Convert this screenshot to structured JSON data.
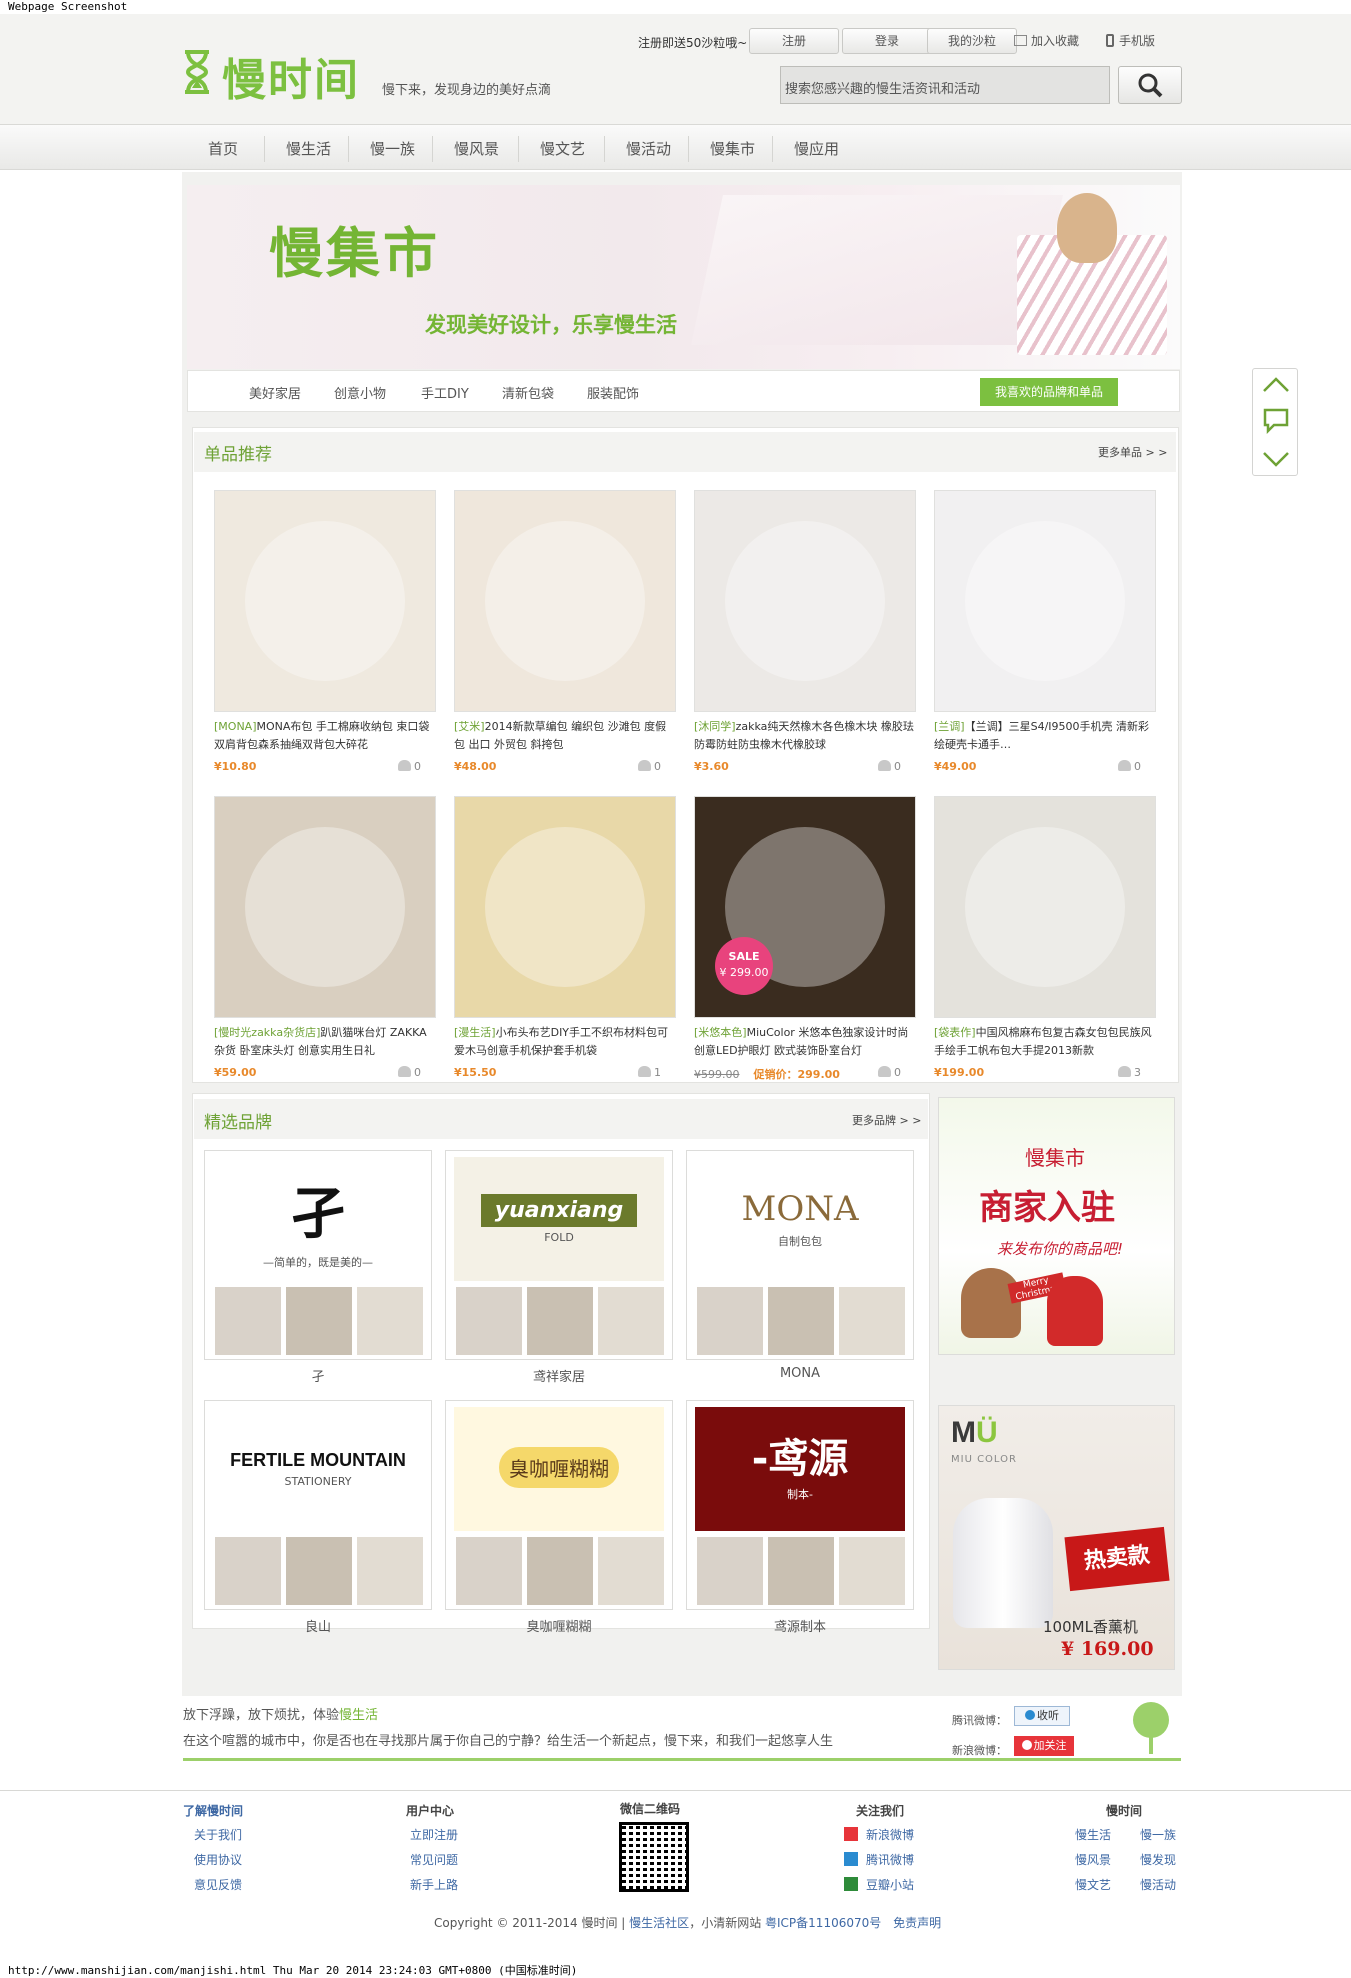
{
  "caption": "Webpage Screenshot",
  "url_footer": "http://www.manshijian.com/manjishi.html Thu Mar 20 2014 23:24:03 GMT+0800 (中国标准时间)",
  "header": {
    "logo_text": "慢时间",
    "slogan": "慢下来，发现身边的美好点滴",
    "promo": "注册即送50沙粒哦~",
    "buttons": {
      "register": "注册",
      "login": "登录",
      "my_sand": "我的沙粒"
    },
    "bookmark": "加入收藏",
    "mobile": "手机版",
    "search_placeholder": "搜索您感兴趣的慢生活资讯和活动"
  },
  "nav": [
    "首页",
    "慢生活",
    "慢一族",
    "慢风景",
    "慢文艺",
    "慢活动",
    "慢集市",
    "慢应用"
  ],
  "banner": {
    "title": "慢集市",
    "subtitle": "发现美好设计，乐享慢生活"
  },
  "subnav": {
    "items": [
      "美好家居",
      "创意小物",
      "手工DIY",
      "清新包袋",
      "服装配饰"
    ],
    "button": "我喜欢的品牌和单品"
  },
  "products": {
    "title": "单品推荐",
    "more": "更多单品 > >",
    "items": [
      {
        "tag": "[MONA]",
        "desc": "MONA布包 手工棉麻收纳包 束口袋双肩背包森系抽绳双背包大碎花",
        "price": "¥10.80",
        "likes": "0"
      },
      {
        "tag": "[艾米]",
        "desc": "2014新款草编包 编织包 沙滩包 度假包 出口 外贸包 斜挎包",
        "price": "¥48.00",
        "likes": "0"
      },
      {
        "tag": "[沐同学]",
        "desc": "zakka纯天然橡木各色橡木块 橡胶珐 防霉防蛀防虫橡木代橡胶球",
        "price": "¥3.60",
        "likes": "0"
      },
      {
        "tag": "[兰调]",
        "desc": "【兰调】三星S4/I9500手机壳 清新彩绘硬壳卡通手…",
        "price": "¥49.00",
        "likes": "0"
      },
      {
        "tag": "[慢时光zakka杂货店]",
        "desc": "趴趴猫咪台灯 ZAKKA杂货 卧室床头灯 创意实用生日礼",
        "price": "¥59.00",
        "likes": "0"
      },
      {
        "tag": "[漫生活]",
        "desc": "小布头布艺DIY手工不织布材料包可爱木马创意手机保护套手机袋",
        "price": "¥15.50",
        "likes": "1"
      },
      {
        "tag": "[米悠本色]",
        "desc": "MiuColor 米悠本色独家设计时尚创意LED护眼灯 欧式装饰卧室台灯",
        "price": "促销价：299.00",
        "old_price": "¥599.00",
        "likes": "0",
        "sale": "SALE",
        "sale_price": "¥ 299.00"
      },
      {
        "tag": "[袋表作]",
        "desc": "中国风棉麻布包复古森女包包民族风手绘手工帆布包大手提2013新款",
        "price": "¥199.00",
        "likes": "3"
      }
    ]
  },
  "brands": {
    "title": "精选品牌",
    "more": "更多品牌 > >",
    "items": [
      {
        "name": "孑",
        "logo": "孑",
        "logo_sub": "—简单的，既是美的—"
      },
      {
        "name": "鸢祥家居",
        "logo": "yuanxiang",
        "logo_sub": "FOLD"
      },
      {
        "name": "MONA",
        "logo": "MONA",
        "logo_sub": "自制包包"
      },
      {
        "name": "良山",
        "logo": "FERTILE MOUNTAIN",
        "logo_sub": "STATIONERY"
      },
      {
        "name": "臭咖喱糊糊",
        "logo": "臭咖喱糊糊",
        "logo_sub": ""
      },
      {
        "name": "鸢源制本",
        "logo": "-鸢源",
        "logo_sub": "制本-"
      }
    ]
  },
  "ads": {
    "merchant": {
      "line1": "慢集市",
      "line2": "商家入驻",
      "line3": "来发布你的商品吧!",
      "merry": "Merry Christmas"
    },
    "miu": {
      "brand": "MIU COLOR",
      "hot": "热卖款",
      "product": "100ML香薰机",
      "price": "¥ 169.00"
    }
  },
  "intro": {
    "line1_pre": "放下浮躁，放下烦扰，体验",
    "line1_link": "慢生活",
    "line2": "在这个喧嚣的城市中，你是否也在寻找那片属于你自己的宁静？给生活一个新起点，慢下来，和我们一起悠享人生",
    "tencent_label": "腾讯微博：",
    "tencent_btn": "收听",
    "sina_label": "新浪微博：",
    "sina_btn": "加关注"
  },
  "footer": {
    "col1": {
      "title": "了解慢时间",
      "links": [
        "关于我们",
        "使用协议",
        "意见反馈"
      ]
    },
    "col2": {
      "title": "用户中心",
      "links": [
        "立即注册",
        "常见问题",
        "新手上路"
      ]
    },
    "col3": {
      "title": "微信二维码"
    },
    "col4": {
      "title": "关注我们",
      "links": [
        "新浪微博",
        "腾讯微博",
        "豆瓣小站"
      ]
    },
    "col5": {
      "title": "慢时间",
      "links": [
        "慢生活",
        "慢一族",
        "慢风景",
        "慢发现",
        "慢文艺",
        "慢活动"
      ]
    },
    "copyright_pre": "Copyright © 2011-2014 慢时间 | ",
    "copyright_link1": "慢生活社区",
    "copyright_mid": "，小清新网站 ",
    "copyright_link2": "粤ICP备11106070号",
    "copyright_link3": "免责声明"
  },
  "colors": {
    "brand_green": "#7cc040",
    "title_green": "#6ea235",
    "price_orange": "#e8892b",
    "link_blue": "#3e68a4",
    "sale_pink": "#e8437d"
  }
}
